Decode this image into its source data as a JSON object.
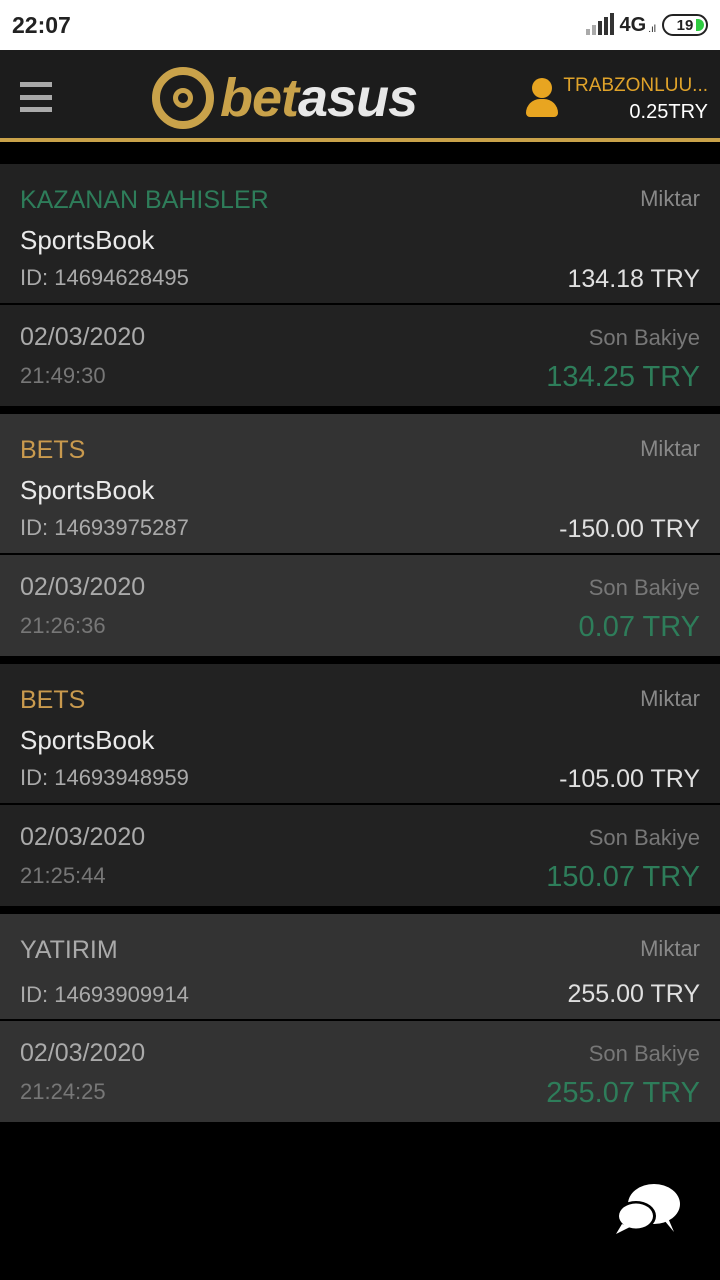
{
  "status_bar": {
    "time": "22:07",
    "network": "4G",
    "network_sub": ".ıl",
    "battery": "19"
  },
  "header": {
    "logo_text_bold": "bet",
    "logo_text_light": "a",
    "logo_text_rest": "sus",
    "username": "TRABZONLUU...",
    "balance": "0.25TRY",
    "accent_color": "#c9a24a"
  },
  "transactions": [
    {
      "category": "KAZANAN BAHISLER",
      "product": "SportsBook",
      "id_text": "ID: 14694628495",
      "amount_label": "Miktar",
      "amount": "134.18 TRY",
      "date": "02/03/2020",
      "time": "21:49:30",
      "balance_label": "Son Bakiye",
      "balance": "134.25 TRY"
    },
    {
      "category": "BETS",
      "product": "SportsBook",
      "id_text": "ID: 14693975287",
      "amount_label": "Miktar",
      "amount": "-150.00 TRY",
      "date": "02/03/2020",
      "time": "21:26:36",
      "balance_label": "Son Bakiye",
      "balance": "0.07 TRY"
    },
    {
      "category": "BETS",
      "product": "SportsBook",
      "id_text": "ID: 14693948959",
      "amount_label": "Miktar",
      "amount": "-105.00 TRY",
      "date": "02/03/2020",
      "time": "21:25:44",
      "balance_label": "Son Bakiye",
      "balance": "150.07 TRY"
    },
    {
      "category": "YATIRIM",
      "product": "",
      "id_text": "ID: 14693909914",
      "amount_label": "Miktar",
      "amount": "255.00 TRY",
      "date": "02/03/2020",
      "time": "21:24:25",
      "balance_label": "Son Bakiye",
      "balance": "255.07 TRY"
    }
  ]
}
